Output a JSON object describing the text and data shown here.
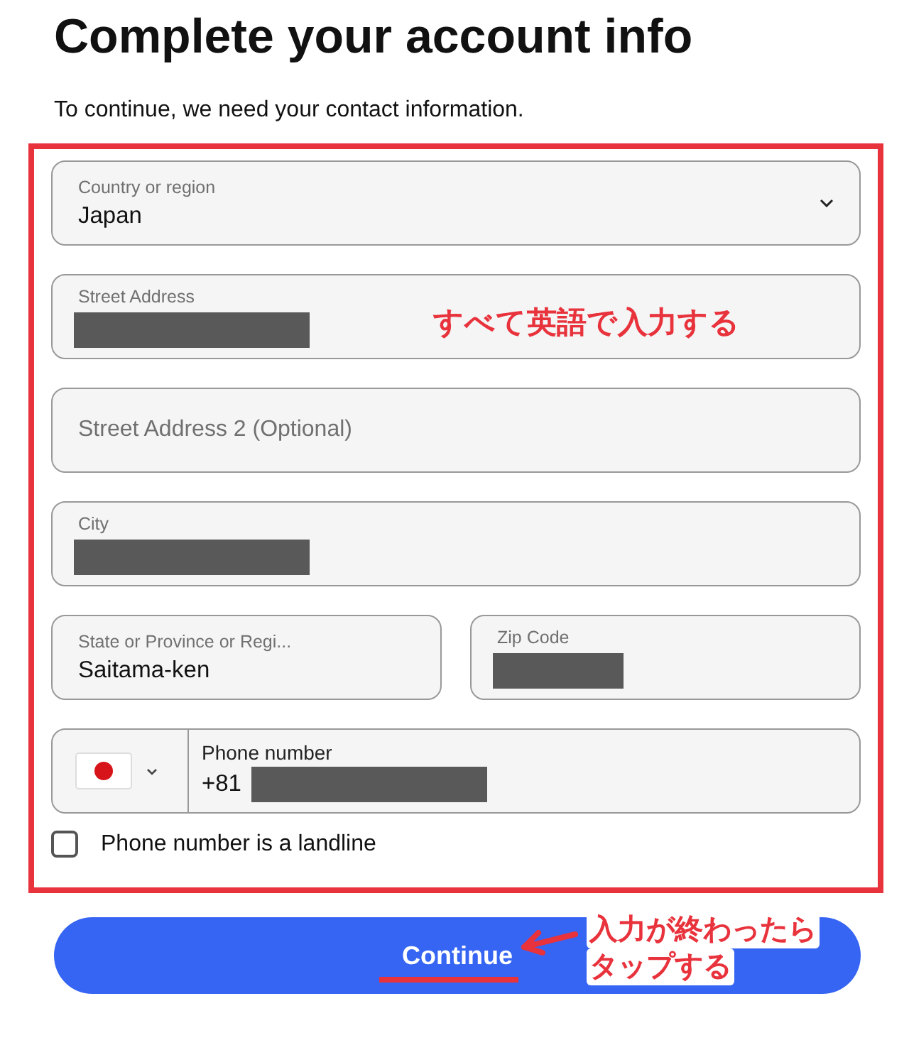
{
  "title": "Complete your account info",
  "subtitle": "To continue, we need your contact information.",
  "form_rows": [
    [
      {
        "kind": "select",
        "label": "Country or region",
        "value": "Japan"
      }
    ],
    [
      {
        "kind": "text",
        "label": "Street Address",
        "redacted": true
      }
    ],
    [
      {
        "kind": "text",
        "placeholder": "Street Address 2 (Optional)"
      }
    ],
    [
      {
        "kind": "text",
        "label": "City",
        "redacted": true
      }
    ],
    [
      {
        "kind": "text",
        "label": "State or Province or Regi...",
        "value": "Saitama-ken"
      },
      {
        "kind": "text",
        "label": "Zip Code",
        "redacted": true
      }
    ],
    [
      {
        "kind": "phone",
        "label": "Phone number",
        "value": "+81",
        "redacted": true
      }
    ]
  ],
  "landline_checkbox": {
    "label": "Phone number is a landline",
    "checked": false
  },
  "continue_button": {
    "label": "Continue"
  },
  "annotations": [
    {
      "text": "すべて英語で入力する"
    },
    {
      "lines": [
        "入力が終わったら",
        "タップする"
      ]
    }
  ]
}
